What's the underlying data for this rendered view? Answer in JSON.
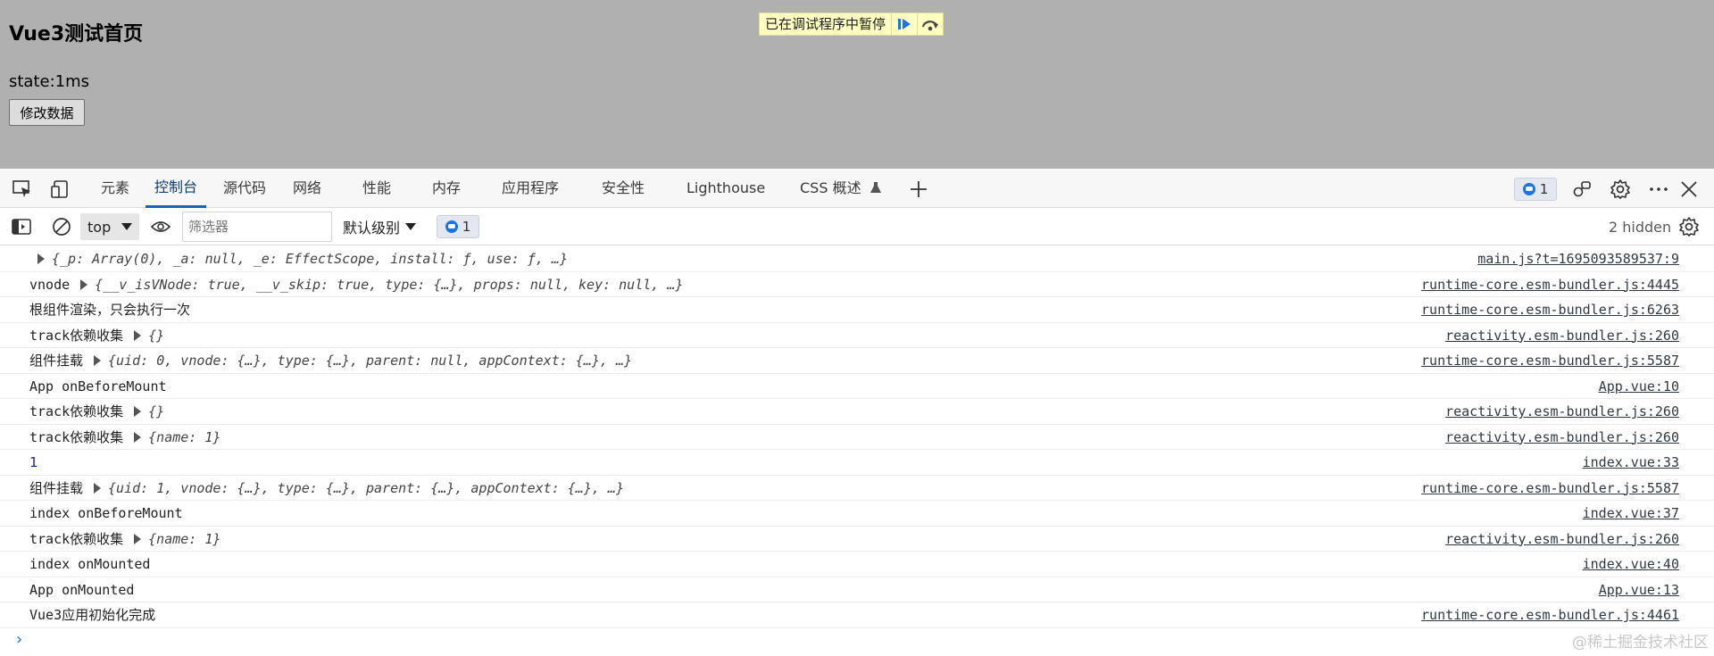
{
  "page": {
    "title": "Vue3测试首页",
    "state_text": "state:1ms",
    "button_label": "修改数据"
  },
  "paused_banner": {
    "text": "已在调试程序中暂停",
    "resume_icon": "resume-icon",
    "step_over_icon": "step-over-icon"
  },
  "devtools": {
    "tabs": [
      {
        "label": "元素"
      },
      {
        "label": "控制台"
      },
      {
        "label": "源代码"
      },
      {
        "label": "网络"
      },
      {
        "label": "性能"
      },
      {
        "label": "内存"
      },
      {
        "label": "应用程序"
      },
      {
        "label": "安全性"
      },
      {
        "label": "Lighthouse"
      },
      {
        "label": "CSS 概述"
      }
    ],
    "active_tab": "控制台",
    "message_count": "1"
  },
  "toolbar": {
    "context": "top",
    "filter_placeholder": "筛选器",
    "level": "默认级别",
    "message_count": "1",
    "hidden_count": "2 hidden"
  },
  "console": {
    "rows": [
      {
        "label": "",
        "object": "{_p: Array(0), _a: null, _e: EffectScope, install: ƒ, use: ƒ, …}",
        "source": "main.js?t=1695093589537:9"
      },
      {
        "label": "vnode",
        "object": "{__v_isVNode: true, __v_skip: true, type: {…}, props: null, key: null, …}",
        "source": "runtime-core.esm-bundler.js:4445"
      },
      {
        "label": "根组件渲染，只会执行一次",
        "object": "",
        "source": "runtime-core.esm-bundler.js:6263"
      },
      {
        "label": "track依赖收集",
        "object": "{}",
        "source": "reactivity.esm-bundler.js:260"
      },
      {
        "label": "组件挂载",
        "object": "{uid: 0, vnode: {…}, type: {…}, parent: null, appContext: {…}, …}",
        "source": "runtime-core.esm-bundler.js:5587"
      },
      {
        "label": "App onBeforeMount",
        "object": "",
        "source": "App.vue:10"
      },
      {
        "label": "track依赖收集",
        "object": "{}",
        "source": "reactivity.esm-bundler.js:260"
      },
      {
        "label": "track依赖收集",
        "object": "{name: 1}",
        "source": "reactivity.esm-bundler.js:260"
      },
      {
        "label": "1",
        "object": "",
        "source": "index.vue:33"
      },
      {
        "label": "组件挂载",
        "object": "{uid: 1, vnode: {…}, type: {…}, parent: {…}, appContext: {…}, …}",
        "source": "runtime-core.esm-bundler.js:5587"
      },
      {
        "label": "index onBeforeMount",
        "object": "",
        "source": "index.vue:37"
      },
      {
        "label": "track依赖收集",
        "object": "{name: 1}",
        "source": "reactivity.esm-bundler.js:260"
      },
      {
        "label": "index onMounted",
        "object": "",
        "source": "index.vue:40"
      },
      {
        "label": "App onMounted",
        "object": "",
        "source": "App.vue:13"
      },
      {
        "label": "Vue3应用初始化完成",
        "object": "",
        "source": "runtime-core.esm-bundler.js:4461"
      }
    ],
    "prompt": "›"
  },
  "watermark": "@稀土掘金技术社区",
  "colors": {
    "accent": "#1a64b7",
    "overlay": "#b0b0b0",
    "banner": "#ffffc2"
  }
}
